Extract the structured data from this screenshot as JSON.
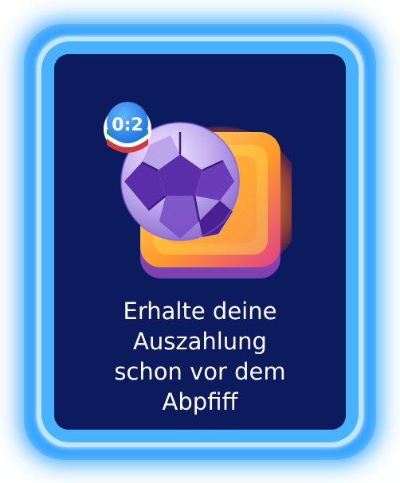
{
  "promo": {
    "score_badge": "0:2",
    "headline_lines": [
      "Erhalte deine",
      "Auszahlung",
      "schon vor dem",
      "Abpfiff"
    ]
  },
  "colors": {
    "card_background": "#0c1a5e",
    "frame_glow": "#3aa6ff",
    "text": "#ffffff"
  },
  "icons": [
    "soccer-ball-icon",
    "score-badge-icon",
    "glowing-tile-icon"
  ]
}
